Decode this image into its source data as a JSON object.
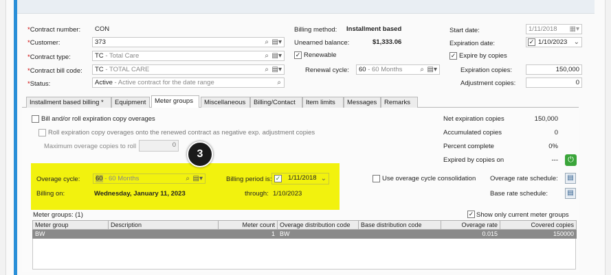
{
  "header": {
    "contract_number_label": "Contract number:",
    "contract_number_value": "CON",
    "customer_label": "Customer:",
    "customer_value": "373",
    "contract_type_label": "Contract type:",
    "contract_type_code": "TC",
    "contract_type_desc": "- Total Care",
    "contract_bill_code_label": "Contract bill code:",
    "contract_bill_code_code": "TC",
    "contract_bill_code_desc": "- TOTAL CARE",
    "status_label": "Status:",
    "status_code": "Active",
    "status_desc": "- Active contract for the date range"
  },
  "billing": {
    "method_label": "Billing method:",
    "method_value": "Installment based",
    "unearned_label": "Unearned balance:",
    "unearned_value": "$1,333.06",
    "renewable_label": "Renewable",
    "renewal_cycle_label": "Renewal cycle:",
    "renewal_cycle_code": "60",
    "renewal_cycle_desc": "- 60 Months"
  },
  "dates": {
    "start_label": "Start date:",
    "start_value": "1/11/2018",
    "expiration_label": "Expiration date:",
    "expiration_value": "1/10/2023",
    "expire_by_copies_label": "Expire by copies",
    "expiration_copies_label": "Expiration copies:",
    "expiration_copies_value": "150,000",
    "adjustment_copies_label": "Adjustment copies:",
    "adjustment_copies_value": "0"
  },
  "tabs": [
    {
      "label": "Installment based billing *"
    },
    {
      "label": "Equipment"
    },
    {
      "label": "Meter groups"
    },
    {
      "label": "Miscellaneous"
    },
    {
      "label": "Billing/Contact"
    },
    {
      "label": "Item limits"
    },
    {
      "label": "Messages"
    },
    {
      "label": "Remarks"
    }
  ],
  "meter": {
    "bill_roll_label": "Bill and/or roll expiration copy overages",
    "roll_expiration_label": "Roll expiration copy overages onto the renewed contract as negative exp. adjustment copies",
    "max_overage_label": "Maximum overage copies to roll",
    "max_overage_value": "0",
    "badge": "3",
    "overage_cycle_label": "Overage cycle:",
    "overage_cycle_code": "60",
    "overage_cycle_desc": "- 60 Months",
    "billing_period_label": "Billing period is:",
    "billing_period_value": "1/11/2018",
    "billing_on_label": "Billing on:",
    "billing_on_value": "Wednesday, January 11, 2023",
    "through_label": "through:",
    "through_value": "1/10/2023",
    "consolidation_label": "Use overage cycle consolidation",
    "overage_rate_schedule_label": "Overage rate schedule:",
    "base_rate_schedule_label": "Base rate schedule:",
    "net_expiration_label": "Net expiration copies",
    "net_expiration_value": "150,000",
    "accumulated_label": "Accumulated copies",
    "accumulated_value": "0",
    "percent_label": "Percent complete",
    "percent_value": "0%",
    "expired_by_copies_label": "Expired by copies on",
    "expired_by_copies_value": "---",
    "meter_groups_label": "Meter groups: (1)",
    "show_current_label": "Show only current meter groups"
  },
  "grid": {
    "columns": [
      "Meter group",
      "Description",
      "Meter count",
      "Overage distribution code",
      "Base distribution code",
      "Overage rate",
      "Covered copies"
    ],
    "rows": [
      [
        "BW",
        "",
        "1",
        "BW",
        "",
        "0.015",
        "150000"
      ]
    ]
  },
  "icons": {
    "lookup": "magnifier-icon",
    "dropdown": "dropdown-icon",
    "calendar": "calendar-icon",
    "schedule": "schedule-icon",
    "power": "power-icon"
  },
  "colors": {
    "highlight": "#f2f20e",
    "accent_bar": "#2a8fd8",
    "selected_row": "#8a8a8a"
  }
}
